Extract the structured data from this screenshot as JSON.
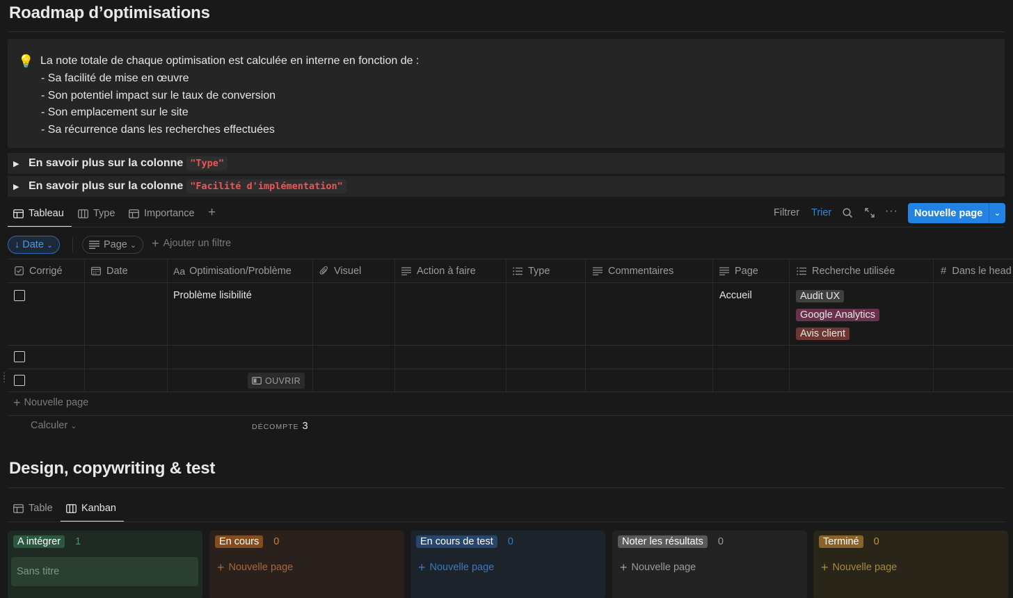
{
  "section1": {
    "title": "Roadmap d’optimisations",
    "callout": {
      "icon": "lightbulb-icon",
      "lines": [
        "La note totale de chaque optimisation est calculée en interne en fonction de :",
        "- Sa facilité de mise en œuvre",
        "- Son potentiel impact sur le taux de conversion",
        "- Son emplacement sur le site",
        "- Sa récurrence dans les recherches effectuées"
      ]
    },
    "toggles": [
      {
        "label": "En savoir plus sur la colonne",
        "code": "\"Type\""
      },
      {
        "label": "En savoir plus sur la colonne",
        "code": "\"Facilité d'implémentation\""
      }
    ],
    "views": [
      {
        "label": "Tableau",
        "icon": "table-icon",
        "active": true
      },
      {
        "label": "Type",
        "icon": "board-icon",
        "active": false
      },
      {
        "label": "Importance",
        "icon": "table-icon",
        "active": false
      }
    ],
    "toolbar": {
      "filter": "Filtrer",
      "sort": "Trier",
      "new_page": "Nouvelle page"
    },
    "filters": {
      "sort_pill": "Date",
      "page_pill": "Page",
      "add_filter": "Ajouter un filtre"
    },
    "columns": [
      {
        "label": "Corrigé",
        "icon": "checkbox-icon"
      },
      {
        "label": "Date",
        "icon": "calendar-icon"
      },
      {
        "label": "Optimisation/Problème",
        "icon": "Aa"
      },
      {
        "label": "Visuel",
        "icon": "paperclip-icon"
      },
      {
        "label": "Action à faire",
        "icon": "text-icon"
      },
      {
        "label": "Type",
        "icon": "list-icon"
      },
      {
        "label": "Commentaires",
        "icon": "text-icon"
      },
      {
        "label": "Page",
        "icon": "text-icon"
      },
      {
        "label": "Recherche utilisée",
        "icon": "list-icon"
      },
      {
        "label": "Dans le head",
        "icon": "#"
      }
    ],
    "rows": [
      {
        "title": "Problème lisibilité",
        "page": "Accueil",
        "tags": [
          {
            "label": "Audit UX",
            "color": "#3f3f3f"
          },
          {
            "label": "Google Analytics",
            "color": "#69314c"
          },
          {
            "label": "Avis client",
            "color": "#6e3630"
          }
        ]
      },
      {
        "title": "",
        "page": "",
        "tags": []
      },
      {
        "title": "",
        "page": "",
        "tags": [],
        "open_label": "OUVRIR"
      }
    ],
    "new_row": "Nouvelle page",
    "calculate": "Calculer",
    "count_label": "DÉCOMPTE",
    "count_value": "3"
  },
  "section2": {
    "title": "Design, copywriting & test",
    "views": [
      {
        "label": "Table",
        "icon": "table-icon",
        "active": false
      },
      {
        "label": "Kanban",
        "icon": "board-icon",
        "active": true
      }
    ],
    "kanban": [
      {
        "label": "A intégrer",
        "count": "1",
        "bg": "#1f2a23",
        "badge": "#2b593f",
        "count_color": "#4f9768",
        "card": "Sans titre"
      },
      {
        "label": "En cours",
        "count": "0",
        "bg": "#2a211d",
        "badge": "#854c1d",
        "count_color": "#cb7b37",
        "new": "Nouvelle page"
      },
      {
        "label": "En cours de test",
        "count": "0",
        "bg": "#1d232b",
        "badge": "#28456c",
        "count_color": "#2e7cd1",
        "new": "Nouvelle page"
      },
      {
        "label": "Noter les résultats",
        "count": "0",
        "bg": "#232323",
        "badge": "#5a5a5a",
        "count_color": "#9b9b9b",
        "new": "Nouvelle page"
      },
      {
        "label": "Terminé",
        "count": "0",
        "bg": "#2a2519",
        "badge": "#89632a",
        "count_color": "#c19138",
        "new": "Nouvelle page"
      }
    ]
  }
}
